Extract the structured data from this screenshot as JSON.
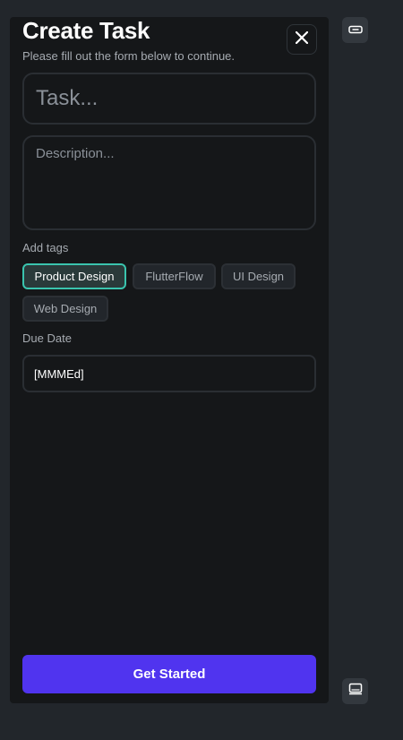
{
  "modal": {
    "title": "Create Task",
    "subtitle": "Please fill out the form below to continue.",
    "close_icon": "close-icon"
  },
  "form": {
    "task": {
      "value": "",
      "placeholder": "Task..."
    },
    "description": {
      "value": "",
      "placeholder": "Description..."
    },
    "tags_label": "Add tags",
    "tags": [
      {
        "label": "Product Design",
        "selected": true
      },
      {
        "label": "FlutterFlow",
        "selected": false
      },
      {
        "label": "UI Design",
        "selected": false
      },
      {
        "label": "Web Design",
        "selected": false
      }
    ],
    "due_date_label": "Due Date",
    "due_date_value": "[MMMEd]",
    "submit_label": "Get Started"
  },
  "side_toolbar": {
    "top_icon": "minimize-icon",
    "bottom_icon": "laptop-icon"
  },
  "colors": {
    "background": "#22262b",
    "panel": "#151719",
    "accent": "#5034ef",
    "tag_selected_border": "#3ac4ae"
  }
}
